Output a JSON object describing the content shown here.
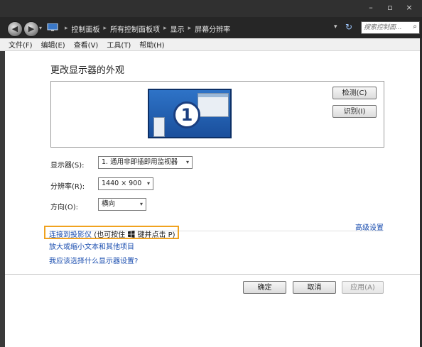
{
  "window": {
    "minimize_glyph": "–",
    "maximize_glyph": "▫",
    "close_glyph": "×"
  },
  "nav": {
    "back_glyph": "◀",
    "forward_glyph": "▶",
    "dropdown_glyph": "▾",
    "breadcrumbs": [
      "控制面板",
      "所有控制面板项",
      "显示",
      "屏幕分辨率"
    ],
    "separator": "▸",
    "history_glyph": "▾",
    "refresh_glyph": "↻",
    "search_placeholder": "搜索控制面...",
    "search_icon_glyph": "⌕"
  },
  "menu": [
    "文件(F)",
    "编辑(E)",
    "查看(V)",
    "工具(T)",
    "帮助(H)"
  ],
  "main": {
    "heading": "更改显示器的外观",
    "monitor_number": "1",
    "detect_button": "检测(C)",
    "identify_button": "识别(I)",
    "display_label": "显示器(S):",
    "display_value": "1. 通用非即插即用监视器",
    "resolution_label": "分辨率(R):",
    "resolution_value": "1440 × 900",
    "orientation_label": "方向(O):",
    "orientation_value": "横向",
    "advanced_link": "高级设置",
    "projector_link": "连接到投影仪",
    "projector_hint_pre": "(也可按住",
    "projector_hint_post": "键并点击 P)",
    "text_size_link": "放大或缩小文本和其他项目",
    "which_settings_link": "我应该选择什么显示器设置?"
  },
  "footer": {
    "ok": "确定",
    "cancel": "取消",
    "apply": "应用(A)"
  },
  "colors": {
    "link": "#1c4fb0",
    "highlight": "#f0a21f",
    "titlebar": "#303030"
  }
}
